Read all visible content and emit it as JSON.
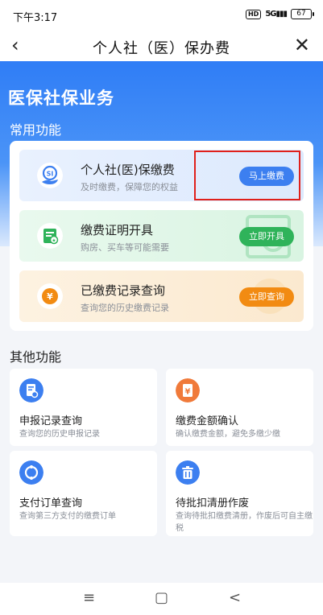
{
  "status_bar": {
    "time": "下午3:17",
    "hd": "HD",
    "network": "5G",
    "battery": "67"
  },
  "nav": {
    "back_icon": "‹",
    "title": "个人社（医）保办费",
    "close_icon": "✕"
  },
  "hero": {
    "title": "医保社保业务"
  },
  "common": {
    "label": "常用功能",
    "items": [
      {
        "title": "个人社(医)保缴费",
        "subtitle": "及时缴费，保障您的权益",
        "button": "马上缴费",
        "color": "#3c7ff0"
      },
      {
        "title": "缴费证明开具",
        "subtitle": "购房、买车等可能需要",
        "button": "立即开具",
        "color": "#2fb35a"
      },
      {
        "title": "已缴费记录查询",
        "subtitle": "查询您的历史缴费记录",
        "button": "立即查询",
        "color": "#f28b12"
      }
    ]
  },
  "other": {
    "label": "其他功能",
    "items": [
      {
        "title": "申报记录查询",
        "subtitle": "查询您的历史申报记录",
        "icon": "document-icon",
        "color": "#3c7ff0"
      },
      {
        "title": "缴费金额确认",
        "subtitle": "确认缴费金额，避免多缴少缴",
        "icon": "yen-icon",
        "color": "#f07a3a"
      },
      {
        "title": "支付订单查询",
        "subtitle": "查询第三方支付的缴费订单",
        "icon": "refresh-icon",
        "color": "#3c7ff0"
      },
      {
        "title": "待批扣清册作废",
        "subtitle": "查询待批扣缴费清册，作废后可自主缴税",
        "icon": "trash-icon",
        "color": "#3c7ff0"
      }
    ]
  },
  "bottom_nav": {
    "menu": "≡",
    "home": "▢",
    "back": "<"
  }
}
